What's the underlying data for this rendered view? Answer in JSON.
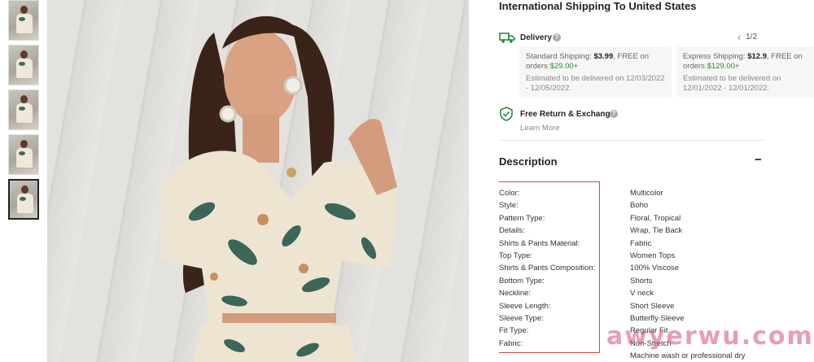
{
  "thumbnails": [
    {
      "name": "thumb-1"
    },
    {
      "name": "thumb-2"
    },
    {
      "name": "thumb-3"
    },
    {
      "name": "thumb-4"
    },
    {
      "name": "thumb-5",
      "active": true
    }
  ],
  "shipping": {
    "title": "International Shipping To United States",
    "delivery_label": "Delivery",
    "help_glyph": "?",
    "pager": "1/2",
    "prev_glyph": "‹",
    "next_glyph": "›",
    "standard": {
      "label": "Standard Shipping:",
      "price": "$3.99",
      "free_text": ", FREE on orders",
      "threshold": "$29.00+",
      "estimate": "Estimated to be delivered on 12/03/2022 - 12/05/2022."
    },
    "express": {
      "label": "Express Shipping:",
      "price": "$12.9",
      "free_text": ", FREE on orders",
      "threshold": "$129.00+",
      "estimate": "Estimated to be delivered on 12/01/2022 - 12/01/2022."
    }
  },
  "returns": {
    "label": "Free Return & Exchange",
    "learn_more": "Learn More"
  },
  "description": {
    "title": "Description",
    "collapse_glyph": "−",
    "attributes": [
      {
        "key": "Color:",
        "value": "Multicolor"
      },
      {
        "key": "Style:",
        "value": "Boho"
      },
      {
        "key": "Pattern Type:",
        "value": "Floral, Tropical"
      },
      {
        "key": "Details:",
        "value": "Wrap, Tie Back"
      },
      {
        "key": "Shirts & Pants Material:",
        "value": "Fabric"
      },
      {
        "key": "Top Type:",
        "value": "Women Tops"
      },
      {
        "key": "Shirts & Pants Composition:",
        "value": "100% Viscose"
      },
      {
        "key": "Bottom Type:",
        "value": "Shorts"
      },
      {
        "key": "Neckline:",
        "value": "V neck"
      },
      {
        "key": "Sleeve Length:",
        "value": "Short Sleeve"
      },
      {
        "key": "Sleeve Type:",
        "value": "Butterfly Sleeve"
      },
      {
        "key": "Fit Type:",
        "value": "Regular Fit"
      },
      {
        "key": "Fabric:",
        "value": "Non-Stretch"
      },
      {
        "key": "",
        "value": "Machine wash or professional dry"
      }
    ]
  },
  "watermark": "awyerwu.com",
  "colors": {
    "highlight_border": "#d9453f",
    "icon_green": "#2a8a3e",
    "watermark": "#d64f78"
  },
  "icons": {
    "delivery": "truck-icon",
    "returns": "shield-check-icon",
    "help": "question-circle-icon",
    "collapse": "minus-icon"
  }
}
